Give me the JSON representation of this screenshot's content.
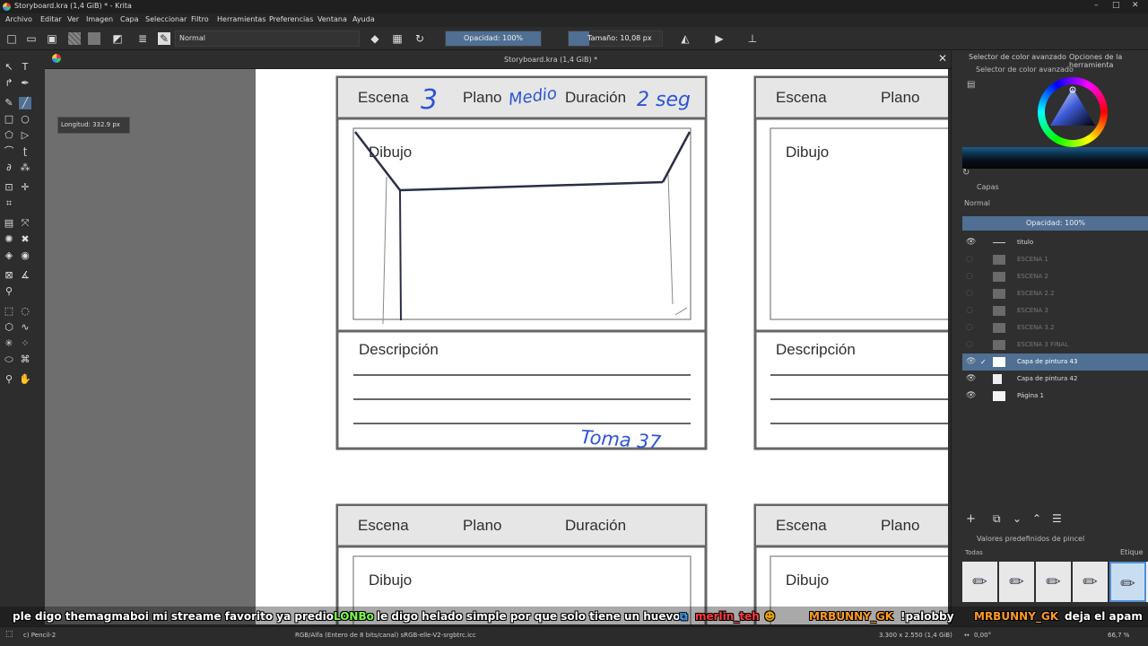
{
  "window": {
    "title": "Storyboard.kra (1,4 GiB) * - Krita",
    "controls": [
      "–",
      "□",
      "✕"
    ]
  },
  "menu": [
    "Archivo",
    "Editar",
    "Ver",
    "Imagen",
    "Capa",
    "Seleccionar",
    "Filtro",
    "Herramientas",
    "Preferencias",
    "Ventana",
    "Ayuda"
  ],
  "toolbar": {
    "blend_mode": "Normal",
    "opacity": "Opacidad: 100%",
    "size": "Tamaño: 10,08 px"
  },
  "document_tab": {
    "name": "Storyboard.kra (1,4 GiB) *"
  },
  "canvas": {
    "length_readout": "Longitud: 332.9 px"
  },
  "storyboard": {
    "labels": {
      "escena": "Escena",
      "plano": "Plano",
      "duracion": "Duración",
      "dibujo": "Dibujo",
      "descripcion": "Descripción"
    },
    "panel1": {
      "escena_value": "3",
      "plano_value": "Medio",
      "duracion_value": "2 seg",
      "toma": "Toma 37"
    }
  },
  "docker": {
    "tabs": [
      "Selector de color avanzado",
      "Opciones de la herramienta"
    ],
    "color_header": "Selector de color avanzado",
    "layers_header": "Capas",
    "blend": "Normal",
    "layer_opacity": "Opacidad:  100%",
    "layers": [
      {
        "name": "titulo",
        "visible": true,
        "selected": false
      },
      {
        "name": "ESCENA 1",
        "visible": false,
        "selected": false
      },
      {
        "name": "ESCENA 2",
        "visible": false,
        "selected": false
      },
      {
        "name": "ESCENA 2.2",
        "visible": false,
        "selected": false
      },
      {
        "name": "ESCENA 3",
        "visible": false,
        "selected": false
      },
      {
        "name": "ESCENA 3.2",
        "visible": false,
        "selected": false
      },
      {
        "name": "ESCENA 3 FINAL",
        "visible": false,
        "selected": false
      },
      {
        "name": "Capa de pintura 43",
        "visible": true,
        "selected": true
      },
      {
        "name": "Capa de pintura 42",
        "visible": true,
        "selected": false
      },
      {
        "name": "Página 1",
        "visible": true,
        "selected": false
      }
    ],
    "presets_header": "Valores predefinidos de pincel",
    "presets_filter": "Todas",
    "presets_tag": "Etique"
  },
  "chat": [
    {
      "user": "",
      "text": "ple digo themagmaboi mi streame favorito ya predio",
      "color": "#ffffff"
    },
    {
      "user": "LONBo",
      "text": "le digo helado simple por que solo tiene un huevo",
      "color": "#7cff4a"
    },
    {
      "user": "merlin_teh",
      "text": "",
      "color": "#ff3b3b"
    },
    {
      "user": "MRBUNNY_GK",
      "text": "!palobby",
      "color": "#ff9a1f"
    },
    {
      "user": "MRBUNNY_GK",
      "text": "deja el apam",
      "color": "#ff9a1f"
    }
  ],
  "status": {
    "brush": "c) Pencil-2",
    "colorspace": "RGB/Alfa (Entero de 8 bits/canal)  sRGB-elle-V2-srgbtrc.icc",
    "dimensions": "3.300 x 2.550 (1,4 GiB)",
    "rotation": "0,00°",
    "zoom": "66,7 %"
  }
}
